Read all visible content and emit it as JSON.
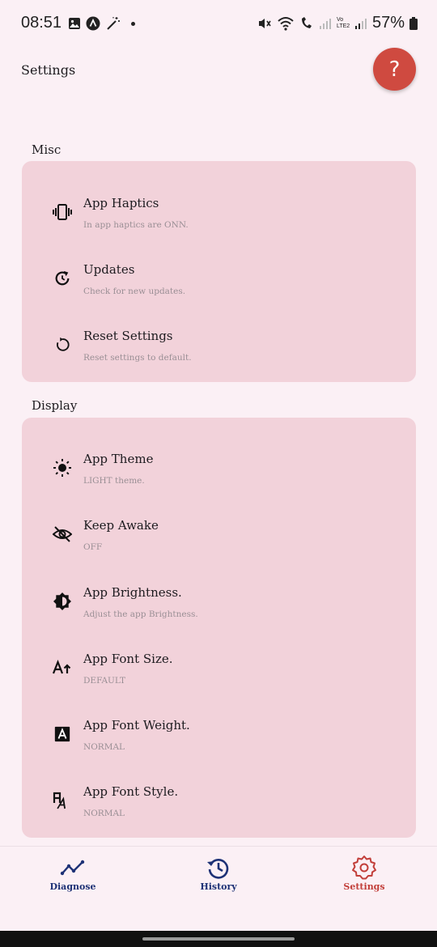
{
  "status_bar": {
    "time": "08:51",
    "battery": "57%",
    "network_label": "Vo LTE2"
  },
  "header": {
    "title": "Settings",
    "help_label": "?"
  },
  "sections": {
    "misc": {
      "title": "Misc",
      "items": [
        {
          "title": "App Haptics",
          "subtitle": "In app haptics are ONN.",
          "icon": "vibration-icon"
        },
        {
          "title": "Updates",
          "subtitle": "Check for new updates.",
          "icon": "update-icon"
        },
        {
          "title": "Reset Settings",
          "subtitle": "Reset settings to default.",
          "icon": "reset-icon"
        }
      ]
    },
    "display": {
      "title": "Display",
      "items": [
        {
          "title": "App Theme",
          "subtitle": "LIGHT theme.",
          "icon": "sun-icon"
        },
        {
          "title": "Keep Awake",
          "subtitle": "OFF",
          "icon": "eye-off-icon"
        },
        {
          "title": "App Brightness.",
          "subtitle": "Adjust the app Brightness.",
          "icon": "brightness-icon"
        },
        {
          "title": "App Font Size.",
          "subtitle": "DEFAULT",
          "icon": "font-size-icon"
        },
        {
          "title": "App Font Weight.",
          "subtitle": "NORMAL",
          "icon": "font-weight-icon"
        },
        {
          "title": "App Font Style.",
          "subtitle": "NORMAL",
          "icon": "font-style-icon"
        }
      ]
    }
  },
  "bottom_nav": {
    "items": [
      {
        "label": "Diagnose",
        "icon": "diagnose-icon",
        "color": "#1e3276"
      },
      {
        "label": "History",
        "icon": "history-icon",
        "color": "#1e3276"
      },
      {
        "label": "Settings",
        "icon": "gear-icon",
        "color": "#c23f3a",
        "active": true
      }
    ]
  },
  "colors": {
    "background": "#fbf0f5",
    "card": "#f2d2da",
    "accent": "#cf4a40",
    "nav_inactive": "#1e3276",
    "nav_active": "#c23f3a"
  }
}
